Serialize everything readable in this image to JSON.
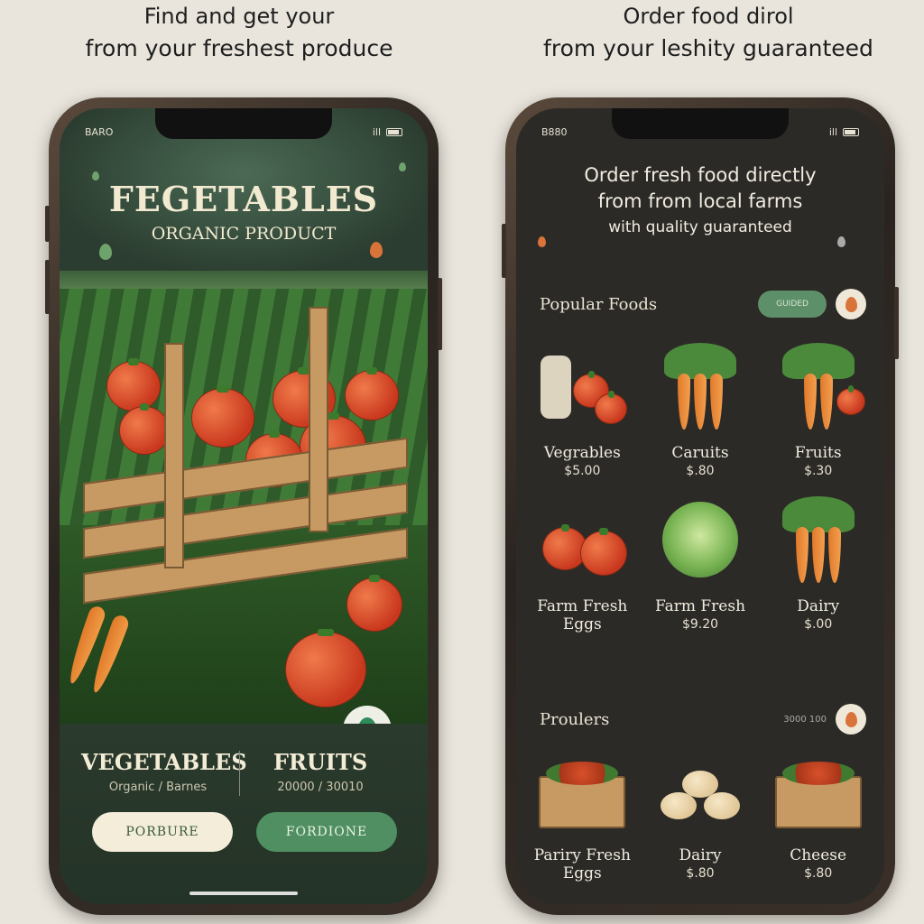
{
  "captions": {
    "left": {
      "line1": "Find and get your",
      "line2": "from your freshest produce"
    },
    "right": {
      "line1": "Order food dirol",
      "line2": "from your leshity guaranteed"
    }
  },
  "left_phone": {
    "status": {
      "carrier": "BARO",
      "signal": "ill"
    },
    "hero_title": "FEGETABLES",
    "hero_subtitle": "ORGANIC PRODUCT",
    "categories": [
      {
        "name": "VEGETABLES",
        "sub": "Organic / Barnes"
      },
      {
        "name": "FRUITS",
        "sub": "20000 / 30010"
      }
    ],
    "buttons": {
      "primary": "PORBURE",
      "secondary": "FORDIONE"
    }
  },
  "right_phone": {
    "status": {
      "carrier": "B880",
      "signal": "ill"
    },
    "headline": {
      "line1": "Order fresh food directly",
      "line2": "from from local farms",
      "line3": "with quality guaranteed"
    },
    "popular": {
      "title": "Popular Foods",
      "pill": "GUIDED",
      "items": [
        {
          "label": "Vegrables",
          "price": "$5.00"
        },
        {
          "label": "Caruits",
          "price": "$.80"
        },
        {
          "label": "Fruits",
          "price": "$.30"
        },
        {
          "label": "Farm Fresh Eggs",
          "price": ""
        },
        {
          "label": "Farm Fresh",
          "price": "$9.20"
        },
        {
          "label": "Dairy",
          "price": "$.00"
        }
      ]
    },
    "producers": {
      "title": "Proulers",
      "tag": "3000 100",
      "items": [
        {
          "label": "Pariry Fresh Eggs",
          "price": ""
        },
        {
          "label": "Dairy",
          "price": "$.80"
        },
        {
          "label": "Cheese",
          "price": "$.80"
        }
      ]
    }
  }
}
